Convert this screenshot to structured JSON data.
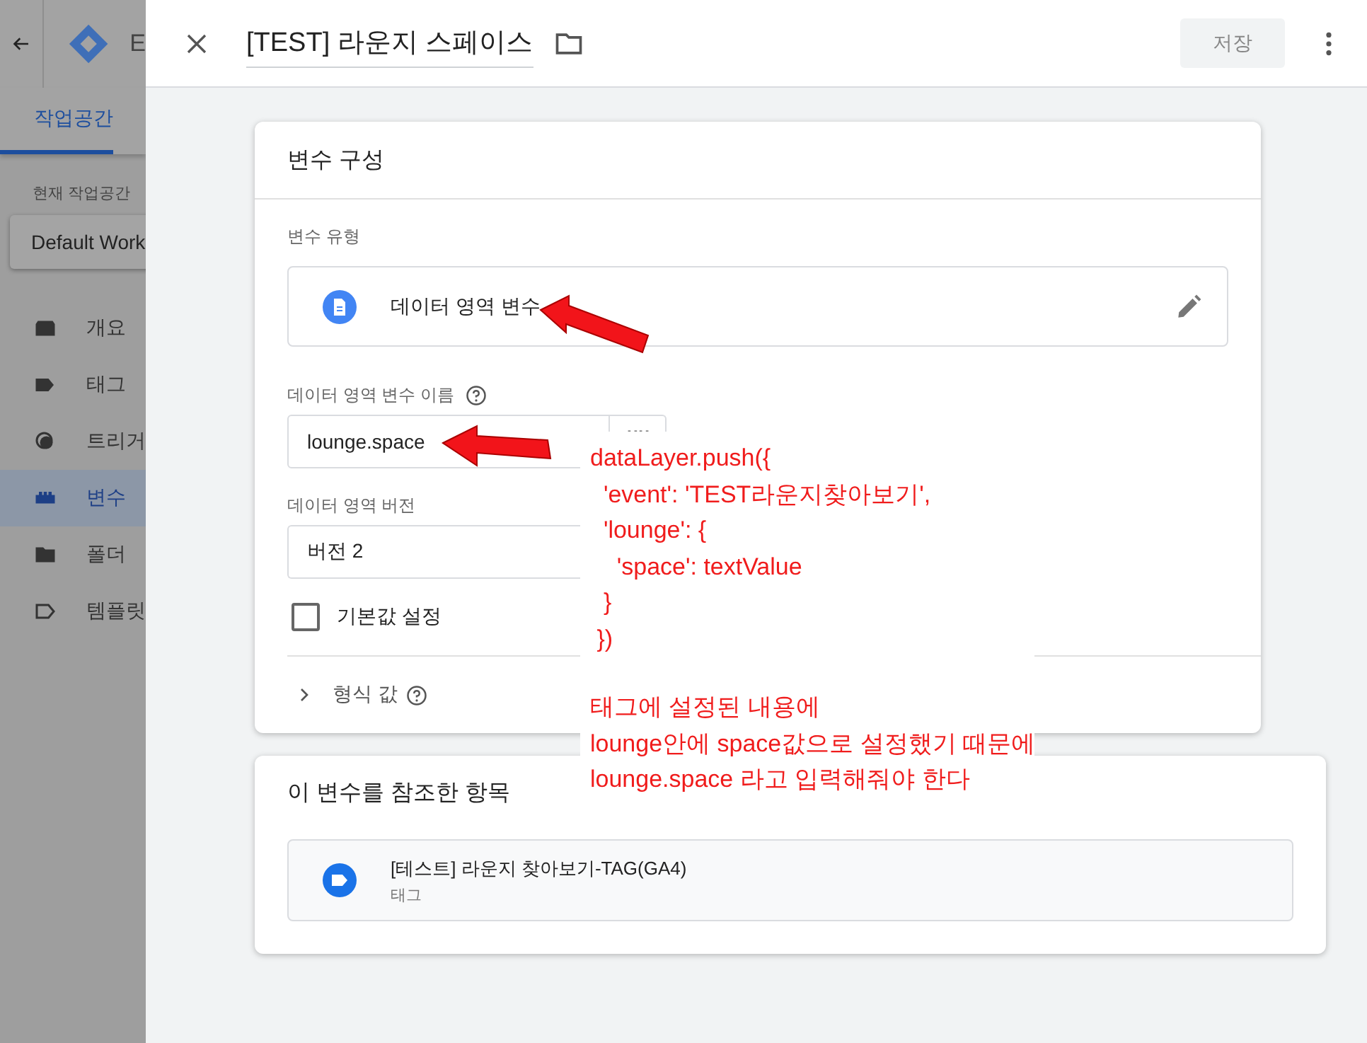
{
  "sidebar": {
    "header_text": "E",
    "tabs": [
      {
        "label": "작업공간",
        "selected": true
      }
    ],
    "workspace_label": "현재 작업공간",
    "workspace": "Default Work",
    "items": [
      {
        "label": "개요",
        "kind": "overview",
        "selected": false
      },
      {
        "label": "태그",
        "kind": "tag",
        "selected": false
      },
      {
        "label": "트리거",
        "kind": "trigger",
        "selected": false
      },
      {
        "label": "변수",
        "kind": "variable",
        "selected": true
      },
      {
        "label": "폴더",
        "kind": "folder",
        "selected": false
      },
      {
        "label": "템플릿",
        "kind": "template",
        "selected": false
      }
    ]
  },
  "header": {
    "title": "[TEST] 라운지 스페이스",
    "save_button": {
      "label": "저장",
      "disabled": true
    }
  },
  "config_card": {
    "title": "변수 구성",
    "type_label": "변수 유형",
    "type_value": "데이터 영역 변수",
    "name_label": "데이터 영역 변수 이름",
    "name_value": "lounge.space",
    "version_label": "데이터 영역 버전",
    "version_value": "버전 2",
    "default_checkbox": {
      "label": "기본값 설정",
      "checked": false
    },
    "format_section": {
      "label": "형식 값",
      "expanded": false
    }
  },
  "references_card": {
    "title": "이 변수를 참조한 항목",
    "items": [
      {
        "title": "[테스트] 라운지 찾아보기-TAG(GA4)",
        "subtitle": "태그"
      }
    ]
  },
  "annotation": {
    "code_lines": [
      "dataLayer.push({",
      "  'event': 'TEST라운지찾아보기',",
      "  'lounge': {",
      "    'space': textValue",
      "  }",
      " })"
    ],
    "note_lines": [
      "태그에 설정된 내용에",
      "lounge안에 space값으로 설정했기 때문에",
      "lounge.space 라고 입력해줘야 한다"
    ]
  }
}
